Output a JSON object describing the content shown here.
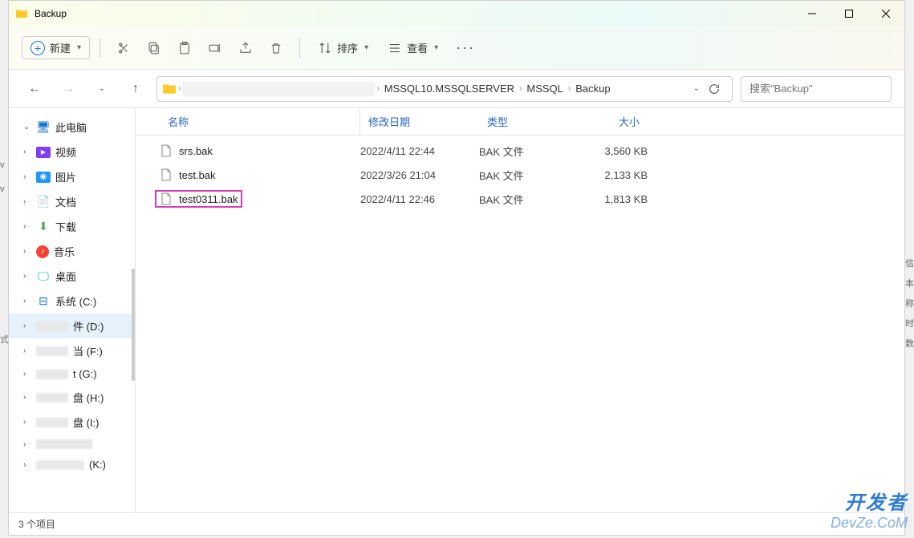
{
  "window_title": "Backup",
  "toolbar": {
    "new_label": "新建",
    "sort_label": "排序",
    "view_label": "查看"
  },
  "breadcrumbs": [
    "MSSQL10.MSSQLSERVER",
    "MSSQL",
    "Backup"
  ],
  "search": {
    "placeholder": "搜索\"Backup\""
  },
  "columns": {
    "name": "名称",
    "date": "修改日期",
    "type": "类型",
    "size": "大小"
  },
  "sidebar": {
    "this_pc": "此电脑",
    "videos": "视频",
    "pictures": "图片",
    "documents": "文档",
    "downloads": "下载",
    "music": "音乐",
    "desktop": "桌面",
    "drive_c": "系统 (C:)",
    "drive_d_suffix": "件 (D:)",
    "drive_f_suffix": "当 (F:)",
    "drive_g_suffix": "t (G:)",
    "drive_h_suffix": "盘 (H:)",
    "drive_i_suffix": "盘 (I:)",
    "drive_k_suffix": "(K:)"
  },
  "files": [
    {
      "name": "srs.bak",
      "date": "2022/4/11 22:44",
      "type": "BAK 文件",
      "size": "3,560 KB",
      "highlight": false
    },
    {
      "name": "test.bak",
      "date": "2022/3/26 21:04",
      "type": "BAK 文件",
      "size": "2,133 KB",
      "highlight": false
    },
    {
      "name": "test0311.bak",
      "date": "2022/4/11 22:46",
      "type": "BAK 文件",
      "size": "1,813 KB",
      "highlight": true
    }
  ],
  "status": "3 个项目",
  "watermark": {
    "line1": "开发者",
    "line2": "DevZe.CoM"
  },
  "edge_text": {
    "l1": "v",
    "l2": "v",
    "l3": "式",
    "r1": "信",
    "r2": "本",
    "r3": "称",
    "r4": "时",
    "r5": "数"
  }
}
